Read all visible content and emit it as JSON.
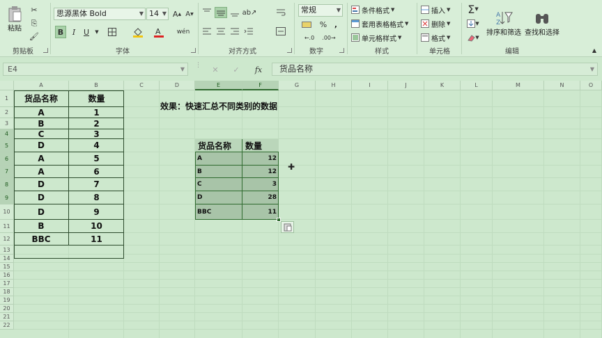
{
  "ribbon": {
    "clipboard": {
      "paste_label": "粘贴",
      "group_label": "剪贴板"
    },
    "font": {
      "font_name": "思源黑体 Bold",
      "font_size": "14",
      "bold": "B",
      "italic": "I",
      "underline": "U",
      "group_label": "字体"
    },
    "alignment": {
      "group_label": "对齐方式"
    },
    "number": {
      "format": "常规",
      "percent": "%",
      "comma": ",",
      "group_label": "数字"
    },
    "styles": {
      "conditional": "条件格式",
      "table": "套用表格格式",
      "cell_styles": "单元格样式",
      "group_label": "样式"
    },
    "cells": {
      "insert": "插入",
      "delete": "删除",
      "format": "格式",
      "group_label": "单元格"
    },
    "editing": {
      "sort_filter": "排序和筛选",
      "find_select": "查找和选择",
      "group_label": "编辑"
    }
  },
  "formula_bar": {
    "name_box": "E4",
    "fx": "fx",
    "value": "货品名称"
  },
  "columns": [
    "A",
    "B",
    "C",
    "D",
    "E",
    "F",
    "G",
    "H",
    "I",
    "J",
    "K",
    "L",
    "M",
    "N",
    "O"
  ],
  "rows": [
    "1",
    "2",
    "3",
    "4",
    "5",
    "6",
    "7",
    "8",
    "9",
    "10",
    "11",
    "12",
    "13",
    "14",
    "15",
    "16",
    "17",
    "18",
    "19",
    "20",
    "21",
    "22"
  ],
  "source_table": {
    "headers": [
      "货品名称",
      "数量"
    ],
    "rows": [
      [
        "A",
        "1"
      ],
      [
        "B",
        "2"
      ],
      [
        "C",
        "3"
      ],
      [
        "D",
        "4"
      ],
      [
        "A",
        "5"
      ],
      [
        "A",
        "6"
      ],
      [
        "D",
        "7"
      ],
      [
        "D",
        "8"
      ],
      [
        "D",
        "9"
      ],
      [
        "B",
        "10"
      ],
      [
        "BBC",
        "11"
      ]
    ]
  },
  "note": "效果：快速汇总不同类别的数据",
  "summary_table": {
    "headers": [
      "货品名称",
      "数量"
    ],
    "rows": [
      [
        "A",
        "12"
      ],
      [
        "B",
        "12"
      ],
      [
        "C",
        "3"
      ],
      [
        "D",
        "28"
      ],
      [
        "BBC",
        "11"
      ]
    ]
  }
}
